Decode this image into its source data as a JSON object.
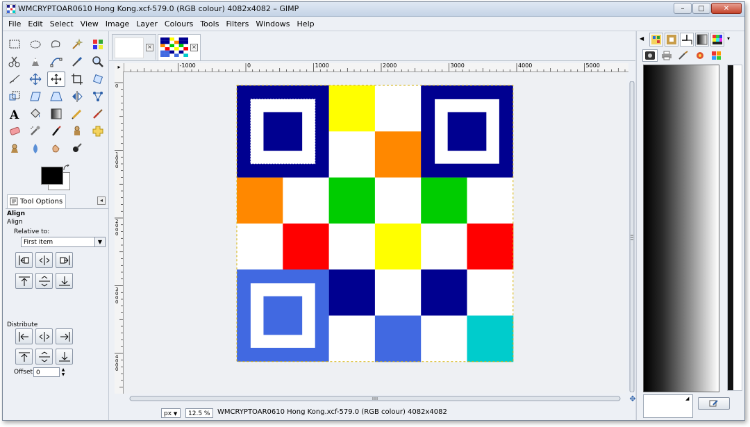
{
  "window": {
    "title": "WMCRYPTOAR0610 Hong Kong.xcf-579.0 (RGB colour) 4082x4082 – GIMP",
    "controls": {
      "minimize": "–",
      "maximize": "□",
      "close": "✕"
    }
  },
  "menubar": {
    "items": [
      "File",
      "Edit",
      "Select",
      "View",
      "Image",
      "Layer",
      "Colours",
      "Tools",
      "Filters",
      "Windows",
      "Help"
    ]
  },
  "toolbox": {
    "tools": [
      "rect-select-icon",
      "ellipse-select-icon",
      "free-select-icon",
      "fuzzy-select-icon",
      "select-by-color-icon",
      "scissors-icon",
      "foreground-select-icon",
      "paths-icon",
      "color-picker-icon",
      "zoom-icon",
      "measure-icon",
      "move-icon",
      "align-icon",
      "crop-icon",
      "rotate-icon",
      "scale-icon",
      "shear-icon",
      "perspective-icon",
      "flip-icon",
      "cage-icon",
      "text-icon",
      "bucket-fill-icon",
      "blend-icon",
      "pencil-icon",
      "paintbrush-icon",
      "eraser-icon",
      "airbrush-icon",
      "ink-icon",
      "clone-icon",
      "heal-icon",
      "perspective-clone-icon",
      "blur-icon",
      "smudge-icon",
      "dodge-burn-icon"
    ],
    "active_tool": "align-icon"
  },
  "tool_options": {
    "tab_label": "Tool Options",
    "heading": "Align",
    "subheading": "Align",
    "relative_to_label": "Relative to:",
    "relative_to_value": "First item",
    "distribute_label": "Distribute",
    "offset_label": "Offset:",
    "offset_value": "0"
  },
  "image_tabs": [
    "blank-image",
    "qr-image"
  ],
  "rulers": {
    "h_labels": [
      "-1000",
      "0",
      "1000",
      "2000",
      "3000",
      "4000",
      "5000"
    ],
    "v_labels": [
      "0",
      "1000",
      "2000",
      "3000",
      "4000"
    ]
  },
  "canvas": {
    "grid_size": 6,
    "colors": {
      "navy": "#000090",
      "yellow": "#ffff00",
      "orange": "#ff8800",
      "green": "#00cc00",
      "red": "#ff0000",
      "royal": "#4169e1",
      "cyan": "#00cccc",
      "white": "#ffffff"
    },
    "cells": [
      [
        "navy",
        "navy",
        "yellow",
        "white",
        "navy",
        "navy"
      ],
      [
        "navy",
        "navy",
        "white",
        "orange",
        "navy",
        "navy"
      ],
      [
        "orange",
        "white",
        "green",
        "white",
        "green",
        "white"
      ],
      [
        "white",
        "red",
        "white",
        "yellow",
        "white",
        "red"
      ],
      [
        "royal",
        "royal",
        "navy",
        "white",
        "navy",
        "white"
      ],
      [
        "royal",
        "royal",
        "white",
        "royal",
        "white",
        "cyan"
      ]
    ]
  },
  "statusbar": {
    "unit": "px",
    "zoom": "12.5 %",
    "text": "WMCRYPTOAR0610 Hong Kong.xcf-579.0 (RGB colour) 4082x4082"
  },
  "right_dock": {
    "tabs": [
      "patterns-tab-icon",
      "brushes-tab-icon",
      "paths-tab-icon",
      "gradients-tab-icon",
      "palettes-tab-icon"
    ],
    "subtabs": [
      "tool-presets-icon",
      "printer-icon",
      "paintbrush-icon",
      "color-icon",
      "palette-icon"
    ]
  }
}
